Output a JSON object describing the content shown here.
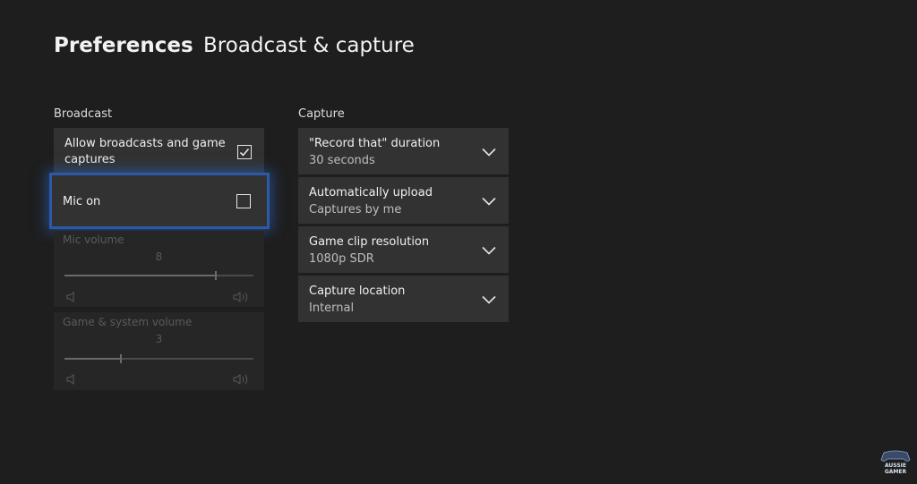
{
  "header": {
    "title_bold": "Preferences",
    "title_light": "Broadcast & capture"
  },
  "broadcast": {
    "section_label": "Broadcast",
    "allow_label": "Allow broadcasts and game captures",
    "allow_checked": true,
    "mic_label": "Mic on",
    "mic_checked": false,
    "mic_volume_label": "Mic volume",
    "mic_volume_value": "8",
    "mic_volume_fraction": 0.8,
    "game_volume_label": "Game & system volume",
    "game_volume_value": "3",
    "game_volume_fraction": 0.3
  },
  "capture": {
    "section_label": "Capture",
    "items": [
      {
        "label": "\"Record that\" duration",
        "value": "30 seconds"
      },
      {
        "label": "Automatically upload",
        "value": "Captures by me"
      },
      {
        "label": "Game clip resolution",
        "value": "1080p SDR"
      },
      {
        "label": "Capture location",
        "value": "Internal"
      }
    ]
  },
  "watermark": {
    "line1": "AUSSIE",
    "line2": "GAMER"
  },
  "colors": {
    "background": "#1e1e1e",
    "tile": "#323232",
    "focus": "#2b5aa8"
  }
}
